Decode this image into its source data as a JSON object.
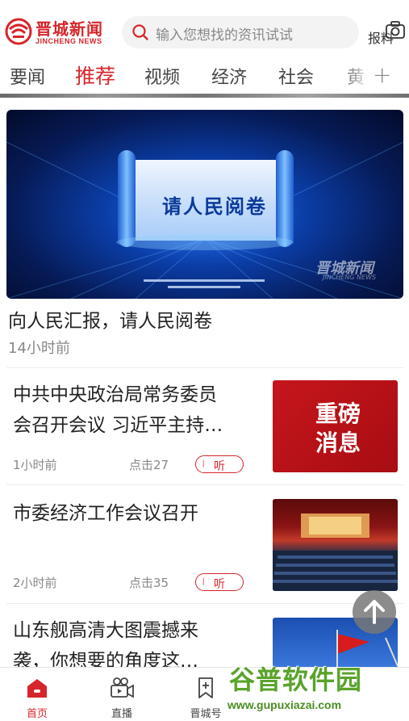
{
  "header": {
    "logo_cn": "晋城新闻",
    "logo_en": "JINCHENG NEWS",
    "search_placeholder": "输入您想找的资讯试试",
    "report_label": "报料"
  },
  "nav": {
    "tabs": [
      {
        "label": "要闻",
        "active": false
      },
      {
        "label": "推荐",
        "active": true
      },
      {
        "label": "视频",
        "active": false
      },
      {
        "label": "经济",
        "active": false
      },
      {
        "label": "社会",
        "active": false
      },
      {
        "label": "黄",
        "active": false
      }
    ],
    "more_label": "+"
  },
  "banner": {
    "title": "请人民阅卷",
    "brand_cn": "晋城新闻",
    "brand_en": "JINCHENG NEWS"
  },
  "hero": {
    "title": "向人民汇报，请人民阅卷",
    "time": "14小时前"
  },
  "articles": [
    {
      "title_line1": "中共中央政治局常务委员",
      "title_line2": "会召开会议  习近平主持…",
      "time": "1小时前",
      "clicks": "点击27",
      "listen_label": "听",
      "thumb_text": "重磅消息"
    },
    {
      "title_line1": "市委经济工作会议召开",
      "title_line2": "",
      "time": "2小时前",
      "clicks": "点击35",
      "listen_label": "听"
    },
    {
      "title_line1": "山东舰高清大图震撼来",
      "title_line2": "袭，你想要的角度这…"
    }
  ],
  "bottom_nav": [
    {
      "label": "首页",
      "icon": "home-icon",
      "active": true
    },
    {
      "label": "直播",
      "icon": "live-camera-icon",
      "active": false
    },
    {
      "label": "晋城号",
      "icon": "bookmark-icon",
      "active": false
    }
  ],
  "watermark": {
    "cn": "谷普软件园",
    "url": "www.gupuxiazai.com"
  },
  "colors": {
    "brand": "#d6262b",
    "muted": "#888888"
  }
}
